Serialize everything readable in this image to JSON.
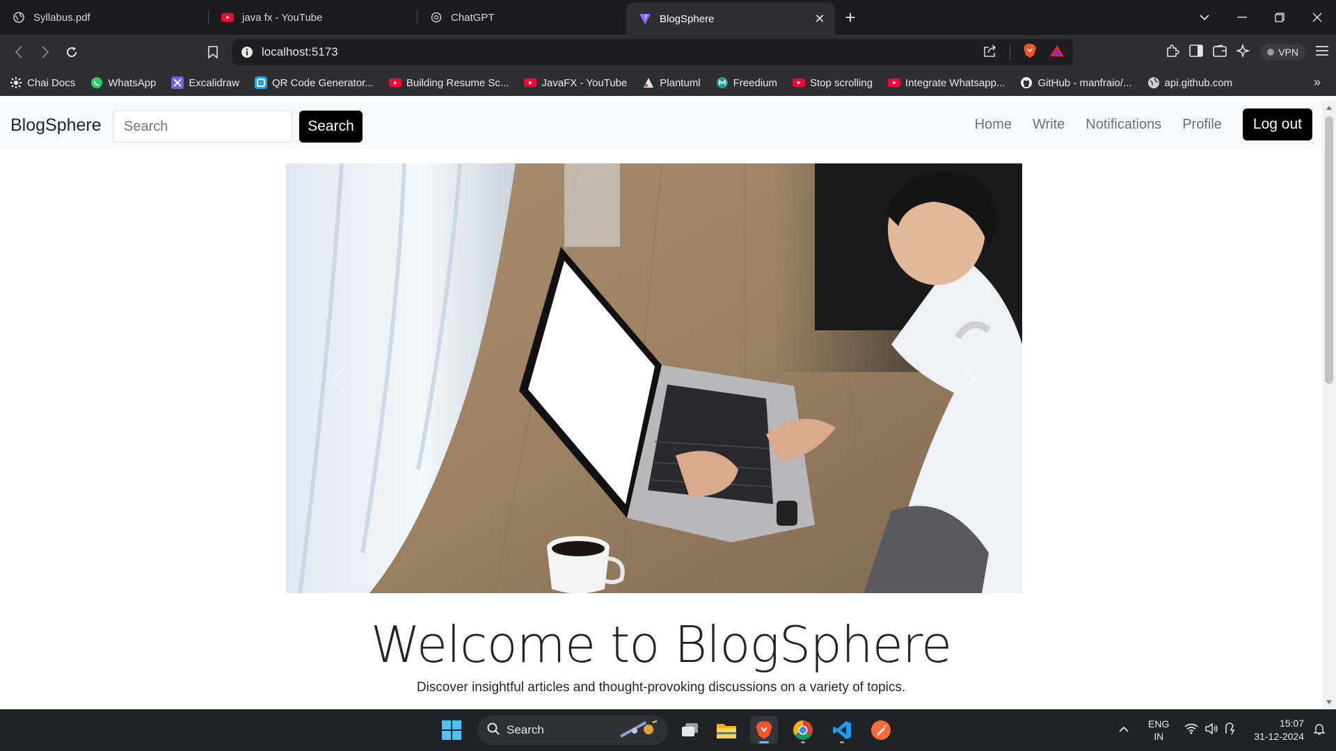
{
  "browser": {
    "tabs": [
      {
        "title": "Syllabus.pdf",
        "icon": "globe-icon"
      },
      {
        "title": "java fx - YouTube",
        "icon": "youtube-icon"
      },
      {
        "title": "ChatGPT",
        "icon": "chatgpt-icon"
      },
      {
        "title": "BlogSphere",
        "icon": "vite-icon",
        "active": true
      }
    ],
    "address": "localhost:5173",
    "vpn_label": "VPN",
    "bookmarks": [
      {
        "label": "Chai Docs",
        "icon": "gear-icon"
      },
      {
        "label": "WhatsApp",
        "icon": "whatsapp-icon"
      },
      {
        "label": "Excalidraw",
        "icon": "excalidraw-icon"
      },
      {
        "label": "QR Code Generator...",
        "icon": "qr-icon"
      },
      {
        "label": "Building Resume Sc...",
        "icon": "youtube-icon"
      },
      {
        "label": "JavaFX - YouTube",
        "icon": "youtube-icon"
      },
      {
        "label": "Plantuml",
        "icon": "plantuml-icon"
      },
      {
        "label": "Freedium",
        "icon": "freedium-icon"
      },
      {
        "label": "Stop scrolling",
        "icon": "youtube-icon"
      },
      {
        "label": "Integrate Whatsapp...",
        "icon": "youtube-icon"
      },
      {
        "label": "GitHub - manfraio/...",
        "icon": "github-icon"
      },
      {
        "label": "api.github.com",
        "icon": "globe-icon"
      }
    ]
  },
  "page": {
    "brand": "BlogSphere",
    "search_placeholder": "Search",
    "search_button": "Search",
    "nav": {
      "home": "Home",
      "write": "Write",
      "notifications": "Notifications",
      "profile": "Profile",
      "logout": "Log out"
    },
    "hero_image": "man typing on laptop on wooden floor with coffee cup",
    "hero_title": "Welcome to BlogSphere",
    "hero_subtitle": "Discover insightful articles and thought-provoking discussions on a variety of topics."
  },
  "taskbar": {
    "search_label": "Search",
    "apps": [
      "file-explorer-icon",
      "brave-icon",
      "chrome-icon",
      "vscode-icon",
      "postman-icon"
    ],
    "lang_top": "ENG",
    "lang_bottom": "IN",
    "time": "15:07",
    "date": "31-12-2024"
  },
  "colors": {
    "tabstrip": "#1c1c1f",
    "toolbar": "#2f2f33",
    "navbar_bg": "#f8f9fa",
    "button_black": "#000000",
    "taskbar": "#1f2228"
  }
}
